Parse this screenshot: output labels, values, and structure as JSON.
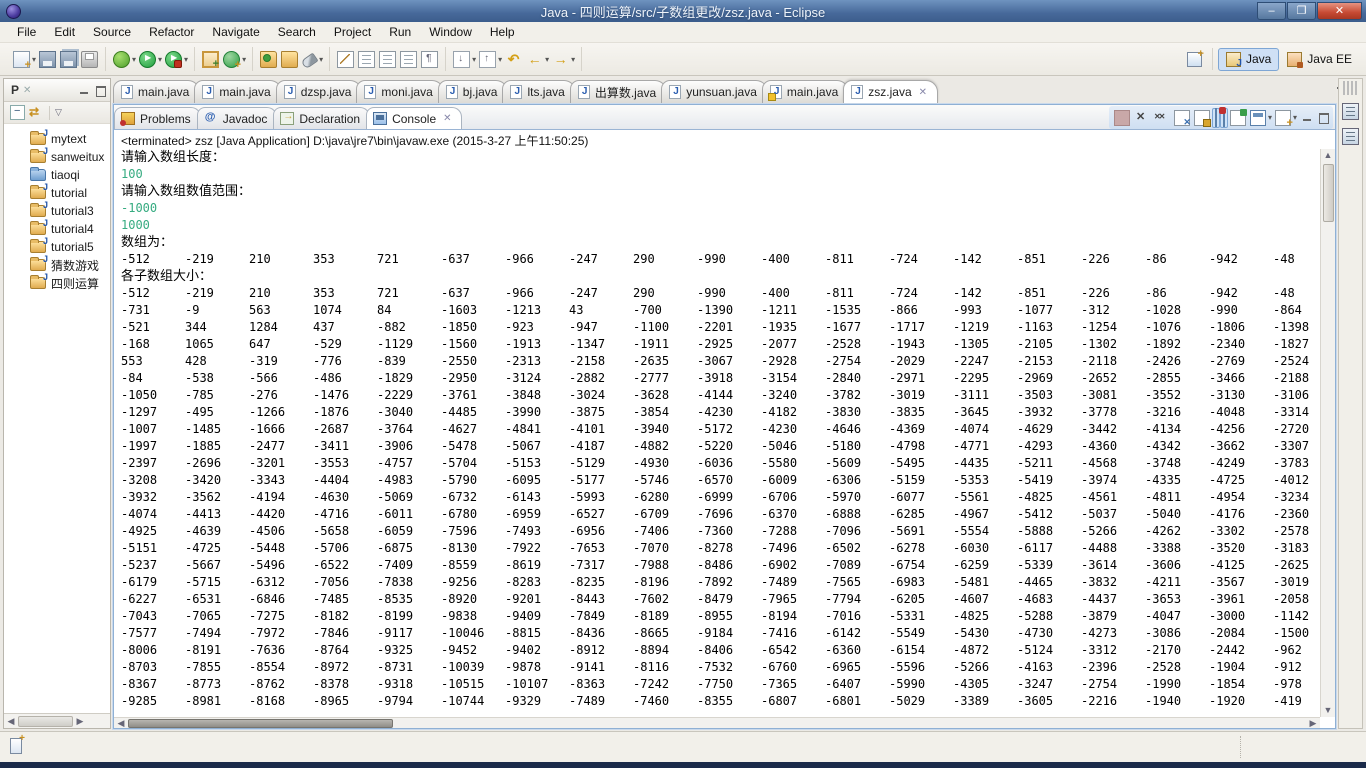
{
  "window": {
    "title": "Java - 四则运算/src/子数组更改/zsz.java - Eclipse",
    "controls": {
      "minimize": "–",
      "maximize": "❐",
      "close": "✕"
    }
  },
  "menu": {
    "items": [
      "File",
      "Edit",
      "Source",
      "Refactor",
      "Navigate",
      "Search",
      "Project",
      "Run",
      "Window",
      "Help"
    ]
  },
  "toolbar": {
    "groups": [
      [
        {
          "n": "new-wizard",
          "dd": true
        },
        {
          "n": "save"
        },
        {
          "n": "save-all"
        },
        {
          "n": "print"
        }
      ],
      [
        {
          "n": "debug",
          "dd": true
        },
        {
          "n": "run",
          "dd": true
        },
        {
          "n": "run-external",
          "dd": true
        }
      ],
      [
        {
          "n": "new-java-project"
        },
        {
          "n": "new-class",
          "dd": true
        }
      ],
      [
        {
          "n": "open-type"
        },
        {
          "n": "open-resource"
        },
        {
          "n": "search",
          "dd": true
        }
      ],
      [
        {
          "n": "mark-occurrences"
        },
        {
          "n": "show-whitespace"
        },
        {
          "n": "block-selection"
        },
        {
          "n": "show-source"
        },
        {
          "n": "format"
        }
      ],
      [
        {
          "n": "next-annotation",
          "dd": true
        },
        {
          "n": "previous-annotation",
          "dd": true
        },
        {
          "n": "last-edit-location"
        },
        {
          "n": "back",
          "dd": true
        },
        {
          "n": "forward",
          "dd": true
        }
      ]
    ]
  },
  "perspectives": {
    "buttons": [
      {
        "label": "Java",
        "active": true
      },
      {
        "label": "Java EE",
        "active": false
      }
    ]
  },
  "sidebar": {
    "tab_label": "P",
    "items": [
      {
        "label": "mytext",
        "type": "java-project"
      },
      {
        "label": "sanweitux",
        "type": "java-project"
      },
      {
        "label": "tiaoqi",
        "type": "folder"
      },
      {
        "label": "tutorial",
        "type": "java-project"
      },
      {
        "label": "tutorial3",
        "type": "java-project"
      },
      {
        "label": "tutorial4",
        "type": "java-project"
      },
      {
        "label": "tutorial5",
        "type": "java-project"
      },
      {
        "label": "猜数游戏",
        "type": "java-project"
      },
      {
        "label": "四则运算",
        "type": "java-project"
      }
    ]
  },
  "editor_tabs": [
    {
      "label": "main.java"
    },
    {
      "label": "main.java"
    },
    {
      "label": "dzsp.java"
    },
    {
      "label": "moni.java"
    },
    {
      "label": "bj.java"
    },
    {
      "label": "lts.java"
    },
    {
      "label": "出算数.java"
    },
    {
      "label": "yunsuan.java"
    },
    {
      "label": "main.java",
      "warn": true
    },
    {
      "label": "zsz.java",
      "active": true
    }
  ],
  "console": {
    "view_tabs": [
      {
        "label": "Problems",
        "icon": "problems"
      },
      {
        "label": "Javadoc",
        "icon": "javadoc"
      },
      {
        "label": "Declaration",
        "icon": "declaration"
      },
      {
        "label": "Console",
        "icon": "console",
        "active": true
      }
    ],
    "status": "<terminated> zsz [Java Application] D:\\java\\jre7\\bin\\javaw.exe (2015-3-27 上午11:50:25)",
    "prompt_length": "请输入数组长度：",
    "input_length": "100",
    "prompt_range": "请输入数组数值范围：",
    "input_min": "-1000",
    "input_max": "1000",
    "array_label": "数组为：",
    "array_row": [
      -512,
      -219,
      210,
      353,
      721,
      -637,
      -966,
      -247,
      290,
      -990,
      -400,
      -811,
      -724,
      -142,
      -851,
      -226,
      -86,
      -942,
      -48
    ],
    "sub_label": "各子数组大小：",
    "rows": [
      [
        -512,
        -219,
        210,
        353,
        721,
        -637,
        -966,
        -247,
        290,
        -990,
        -400,
        -811,
        -724,
        -142,
        -851,
        -226,
        -86,
        -942,
        -48
      ],
      [
        -731,
        -9,
        563,
        1074,
        84,
        -1603,
        -1213,
        43,
        -700,
        -1390,
        -1211,
        -1535,
        -866,
        -993,
        -1077,
        -312,
        -1028,
        -990,
        -864
      ],
      [
        -521,
        344,
        1284,
        437,
        -882,
        -1850,
        -923,
        -947,
        -1100,
        -2201,
        -1935,
        -1677,
        -1717,
        -1219,
        -1163,
        -1254,
        -1076,
        -1806,
        -1398
      ],
      [
        -168,
        1065,
        647,
        -529,
        -1129,
        -1560,
        -1913,
        -1347,
        -1911,
        -2925,
        -2077,
        -2528,
        -1943,
        -1305,
        -2105,
        -1302,
        -1892,
        -2340,
        -1827
      ],
      [
        553,
        428,
        -319,
        -776,
        -839,
        -2550,
        -2313,
        -2158,
        -2635,
        -3067,
        -2928,
        -2754,
        -2029,
        -2247,
        -2153,
        -2118,
        -2426,
        -2769,
        -2524
      ],
      [
        -84,
        -538,
        -566,
        -486,
        -1829,
        -2950,
        -3124,
        -2882,
        -2777,
        -3918,
        -3154,
        -2840,
        -2971,
        -2295,
        -2969,
        -2652,
        -2855,
        -3466,
        -2188
      ],
      [
        -1050,
        -785,
        -276,
        -1476,
        -2229,
        -3761,
        -3848,
        -3024,
        -3628,
        -4144,
        -3240,
        -3782,
        -3019,
        -3111,
        -3503,
        -3081,
        -3552,
        -3130,
        -3106
      ],
      [
        -1297,
        -495,
        -1266,
        -1876,
        -3040,
        -4485,
        -3990,
        -3875,
        -3854,
        -4230,
        -4182,
        -3830,
        -3835,
        -3645,
        -3932,
        -3778,
        -3216,
        -4048,
        -3314
      ],
      [
        -1007,
        -1485,
        -1666,
        -2687,
        -3764,
        -4627,
        -4841,
        -4101,
        -3940,
        -5172,
        -4230,
        -4646,
        -4369,
        -4074,
        -4629,
        -3442,
        -4134,
        -4256,
        -2720
      ],
      [
        -1997,
        -1885,
        -2477,
        -3411,
        -3906,
        -5478,
        -5067,
        -4187,
        -4882,
        -5220,
        -5046,
        -5180,
        -4798,
        -4771,
        -4293,
        -4360,
        -4342,
        -3662,
        -3307
      ],
      [
        -2397,
        -2696,
        -3201,
        -3553,
        -4757,
        -5704,
        -5153,
        -5129,
        -4930,
        -6036,
        -5580,
        -5609,
        -5495,
        -4435,
        -5211,
        -4568,
        -3748,
        -4249,
        -3783
      ],
      [
        -3208,
        -3420,
        -3343,
        -4404,
        -4983,
        -5790,
        -6095,
        -5177,
        -5746,
        -6570,
        -6009,
        -6306,
        -5159,
        -5353,
        -5419,
        -3974,
        -4335,
        -4725,
        -4012
      ],
      [
        -3932,
        -3562,
        -4194,
        -4630,
        -5069,
        -6732,
        -6143,
        -5993,
        -6280,
        -6999,
        -6706,
        -5970,
        -6077,
        -5561,
        -4825,
        -4561,
        -4811,
        -4954,
        -3234
      ],
      [
        -4074,
        -4413,
        -4420,
        -4716,
        -6011,
        -6780,
        -6959,
        -6527,
        -6709,
        -7696,
        -6370,
        -6888,
        -6285,
        -4967,
        -5412,
        -5037,
        -5040,
        -4176,
        -2360
      ],
      [
        -4925,
        -4639,
        -4506,
        -5658,
        -6059,
        -7596,
        -7493,
        -6956,
        -7406,
        -7360,
        -7288,
        -7096,
        -5691,
        -5554,
        -5888,
        -5266,
        -4262,
        -3302,
        -2578
      ],
      [
        -5151,
        -4725,
        -5448,
        -5706,
        -6875,
        -8130,
        -7922,
        -7653,
        -7070,
        -8278,
        -7496,
        -6502,
        -6278,
        -6030,
        -6117,
        -4488,
        -3388,
        -3520,
        -3183
      ],
      [
        -5237,
        -5667,
        -5496,
        -6522,
        -7409,
        -8559,
        -8619,
        -7317,
        -7988,
        -8486,
        -6902,
        -7089,
        -6754,
        -6259,
        -5339,
        -3614,
        -3606,
        -4125,
        -2625
      ],
      [
        -6179,
        -5715,
        -6312,
        -7056,
        -7838,
        -9256,
        -8283,
        -8235,
        -8196,
        -7892,
        -7489,
        -7565,
        -6983,
        -5481,
        -4465,
        -3832,
        -4211,
        -3567,
        -3019
      ],
      [
        -6227,
        -6531,
        -6846,
        -7485,
        -8535,
        -8920,
        -9201,
        -8443,
        -7602,
        -8479,
        -7965,
        -7794,
        -6205,
        -4607,
        -4683,
        -4437,
        -3653,
        -3961,
        -2058
      ],
      [
        -7043,
        -7065,
        -7275,
        -8182,
        -8199,
        -9838,
        -9409,
        -7849,
        -8189,
        -8955,
        -8194,
        -7016,
        -5331,
        -4825,
        -5288,
        -3879,
        -4047,
        -3000,
        -1142
      ],
      [
        -7577,
        -7494,
        -7972,
        -7846,
        -9117,
        -10046,
        -8815,
        -8436,
        -8665,
        -9184,
        -7416,
        -6142,
        -5549,
        -5430,
        -4730,
        -4273,
        -3086,
        -2084,
        -1500
      ],
      [
        -8006,
        -8191,
        -7636,
        -8764,
        -9325,
        -9452,
        -9402,
        -8912,
        -8894,
        -8406,
        -6542,
        -6360,
        -6154,
        -4872,
        -5124,
        -3312,
        -2170,
        -2442,
        -962
      ],
      [
        -8703,
        -7855,
        -8554,
        -8972,
        -8731,
        -10039,
        -9878,
        -9141,
        -8116,
        -7532,
        -6760,
        -6965,
        -5596,
        -5266,
        -4163,
        -2396,
        -2528,
        -1904,
        -912
      ],
      [
        -8367,
        -8773,
        -8762,
        -8378,
        -9318,
        -10515,
        -10107,
        -8363,
        -7242,
        -7750,
        -7365,
        -6407,
        -5990,
        -4305,
        -3247,
        -2754,
        -1990,
        -1854,
        -978
      ],
      [
        -9285,
        -8981,
        -8168,
        -8965,
        -9794,
        -10744,
        -9329,
        -7489,
        -7460,
        -8355,
        -6807,
        -6801,
        -5029,
        -3389,
        -3605,
        -2216,
        -1940,
        -1920,
        -419
      ]
    ]
  }
}
